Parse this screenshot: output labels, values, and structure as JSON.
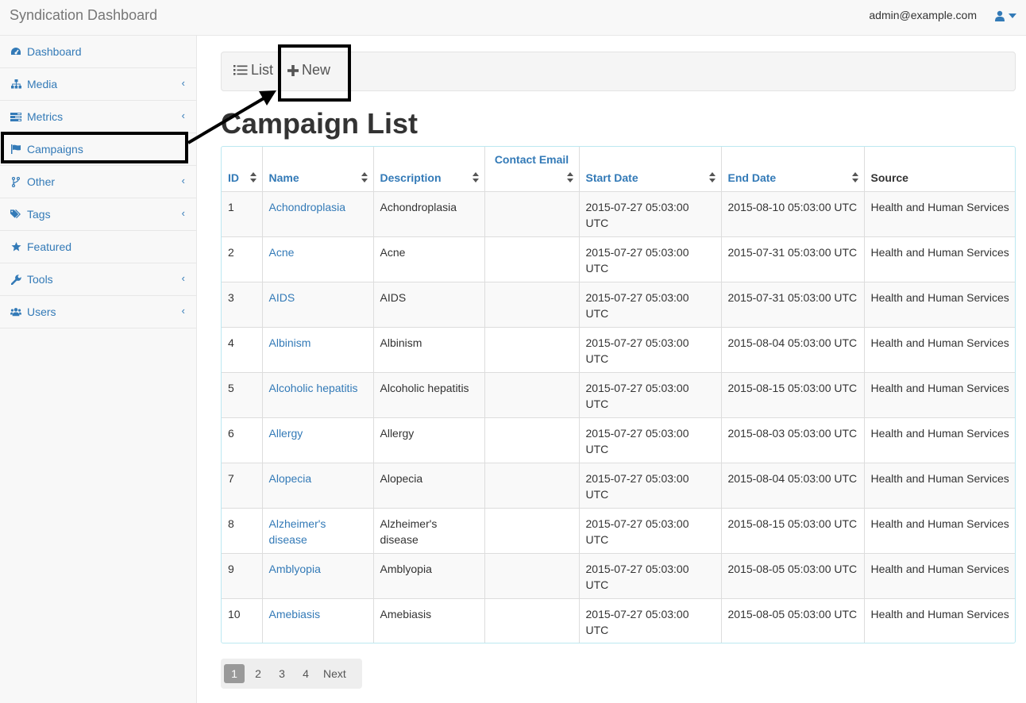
{
  "header": {
    "brand": "Syndication Dashboard",
    "user_email": "admin@example.com",
    "user_icon": "user-icon",
    "caret_icon": "caret-down-icon"
  },
  "sidebar": {
    "items": [
      {
        "label": "Dashboard",
        "icon": "dashboard-icon"
      },
      {
        "label": "Media",
        "icon": "sitemap-icon",
        "chevron": "‹"
      },
      {
        "label": "Metrics",
        "icon": "tasks-icon",
        "chevron": "‹"
      },
      {
        "label": "Campaigns",
        "icon": "flag-icon"
      },
      {
        "label": "Other",
        "icon": "code-fork-icon",
        "chevron": "‹"
      },
      {
        "label": "Tags",
        "icon": "tags-icon",
        "chevron": "‹"
      },
      {
        "label": "Featured",
        "icon": "star-icon"
      },
      {
        "label": "Tools",
        "icon": "wrench-icon",
        "chevron": "‹"
      },
      {
        "label": "Users",
        "icon": "users-icon",
        "chevron": "‹"
      }
    ]
  },
  "toolbar": {
    "list_label": "List",
    "new_label": "New"
  },
  "page_title": "Campaign List",
  "table": {
    "headers": [
      "ID",
      "Name",
      "Description",
      "Contact Email",
      "Start Date",
      "End Date",
      "Source"
    ],
    "rows": [
      [
        "1",
        "Achondroplasia",
        "Achondroplasia",
        "",
        "2015-07-27 05:03:00 UTC",
        "2015-08-10 05:03:00 UTC",
        "Health and Human Services"
      ],
      [
        "2",
        "Acne",
        "Acne",
        "",
        "2015-07-27 05:03:00 UTC",
        "2015-07-31 05:03:00 UTC",
        "Health and Human Services"
      ],
      [
        "3",
        "AIDS",
        "AIDS",
        "",
        "2015-07-27 05:03:00 UTC",
        "2015-07-31 05:03:00 UTC",
        "Health and Human Services"
      ],
      [
        "4",
        "Albinism",
        "Albinism",
        "",
        "2015-07-27 05:03:00 UTC",
        "2015-08-04 05:03:00 UTC",
        "Health and Human Services"
      ],
      [
        "5",
        "Alcoholic hepatitis",
        "Alcoholic hepatitis",
        "",
        "2015-07-27 05:03:00 UTC",
        "2015-08-15 05:03:00 UTC",
        "Health and Human Services"
      ],
      [
        "6",
        "Allergy",
        "Allergy",
        "",
        "2015-07-27 05:03:00 UTC",
        "2015-08-03 05:03:00 UTC",
        "Health and Human Services"
      ],
      [
        "7",
        "Alopecia",
        "Alopecia",
        "",
        "2015-07-27 05:03:00 UTC",
        "2015-08-04 05:03:00 UTC",
        "Health and Human Services"
      ],
      [
        "8",
        "Alzheimer's disease",
        "Alzheimer's disease",
        "",
        "2015-07-27 05:03:00 UTC",
        "2015-08-15 05:03:00 UTC",
        "Health and Human Services"
      ],
      [
        "9",
        "Amblyopia",
        "Amblyopia",
        "",
        "2015-07-27 05:03:00 UTC",
        "2015-08-05 05:03:00 UTC",
        "Health and Human Services"
      ],
      [
        "10",
        "Amebiasis",
        "Amebiasis",
        "",
        "2015-07-27 05:03:00 UTC",
        "2015-08-05 05:03:00 UTC",
        "Health and Human Services"
      ]
    ]
  },
  "pagination": {
    "pages": [
      "1",
      "2",
      "3",
      "4"
    ],
    "next_label": "Next",
    "active": "1"
  },
  "colors": {
    "link": "#337ab7",
    "annotation": "#000000"
  }
}
